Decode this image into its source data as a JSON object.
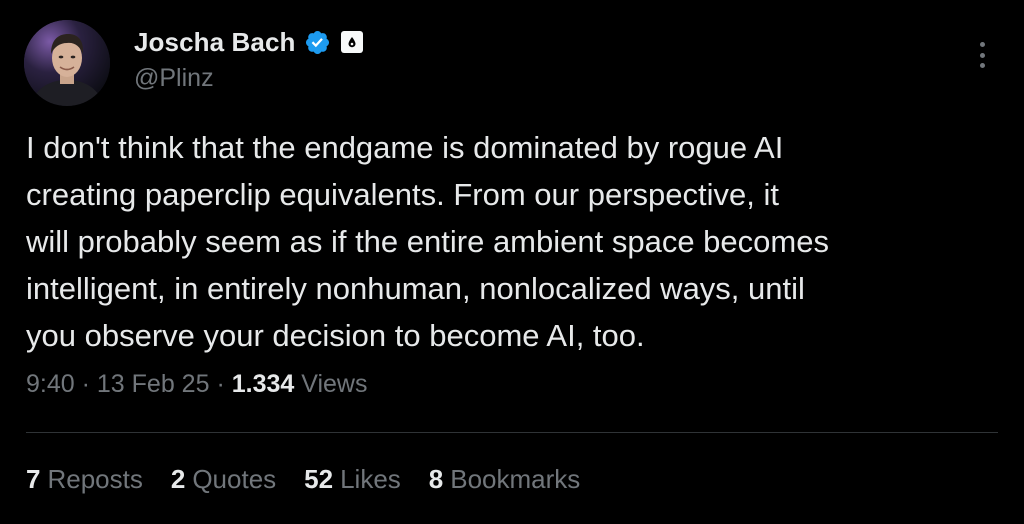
{
  "author": {
    "name": "Joscha Bach",
    "handle": "@Plinz"
  },
  "tweet": {
    "lines": [
      "I don't think that the endgame is dominated by rogue AI",
      "creating paperclip equivalents. From our perspective, it",
      "will probably seem as if the entire ambient space becomes",
      "intelligent, in entirely nonhuman, nonlocalized ways, until",
      "you observe your decision to become AI, too."
    ]
  },
  "meta": {
    "time": "9:40",
    "separator": "·",
    "date": "13 Feb 25",
    "views_count": "1.334",
    "views_label": "Views"
  },
  "stats": [
    {
      "count": "7",
      "label": "Reposts"
    },
    {
      "count": "2",
      "label": "Quotes"
    },
    {
      "count": "52",
      "label": "Likes"
    },
    {
      "count": "8",
      "label": "Bookmarks"
    }
  ],
  "colors": {
    "background": "#000000",
    "text_primary": "#e7e9ea",
    "text_secondary": "#71767b",
    "verified_blue": "#1d9bf0",
    "divider": "#2f3336"
  },
  "icons": {
    "verified": "verified-badge-icon",
    "affiliate": "affiliate-badge-icon",
    "more": "more-options-icon"
  }
}
